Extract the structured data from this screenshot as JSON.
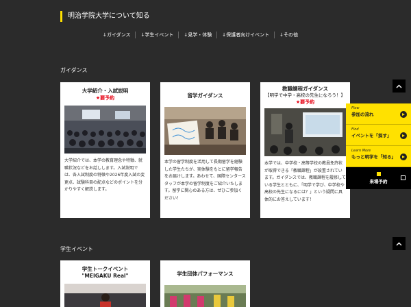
{
  "header": {
    "title": "明治学院大学について知る"
  },
  "nav": [
    "↓ガイダンス",
    "↓学生イベント",
    "↓見学・体験",
    "↓保護者向けイベント",
    "↓その他"
  ],
  "sections": {
    "guidance": {
      "label": "ガイダンス"
    },
    "events": {
      "label": "学生イベント"
    }
  },
  "cards": [
    {
      "title": "大学紹介・入試説明",
      "required": "★要予約",
      "text": "大学紹介では、本学の教育理念や特徴、就職状況などをお話しします。入試説明では、各入試制度の特徴や2026年度入試の変更点、試験科目の配点などのポイントを分かりやすく解説します。"
    },
    {
      "title": "留学ガイダンス",
      "text": "本学の留学制度を活用して長期留学を経験した学生たちが、実体験をもとに留学報告をお届けします。あわせて、国際センタースタッフが本学の留学制度をご紹介いたします。留学に関心のある方は、ぜひご参加ください！"
    },
    {
      "title": "教職課程ガイダンス",
      "subtitle": "【明学で中学・高校の先生になろう！】",
      "required": "★要予約",
      "text": "本学では、中学校・高等学校の教員免許状が取得できる「教職課程」が設置されています。ガイダンスでは、教職課程を履修している学生とともに、「明学で学び、中学校や高校の先生になるには？」という疑問に具体的にお答えしています！"
    },
    {
      "title": "学生トークイベント",
      "subtitle": "\"MEIGAKU Real\""
    },
    {
      "title": "学生団体パフォーマンス"
    }
  ],
  "side_panel": {
    "items": [
      {
        "small": "Flow",
        "main": "参加の流れ"
      },
      {
        "small": "Find",
        "main": "イベントを「探す」"
      },
      {
        "small": "Learn More",
        "main": "もっと明学を「知る」"
      }
    ],
    "visit": "来場予約"
  },
  "colors": {
    "accent": "#ffe100",
    "required": "#e60012",
    "background": "#2b2b2b"
  }
}
